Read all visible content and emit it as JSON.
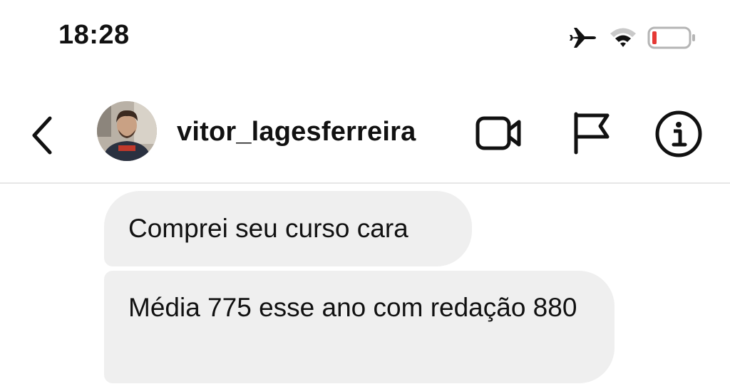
{
  "status_bar": {
    "time": "18:28",
    "icons": [
      "airplane-icon",
      "wifi-icon",
      "battery-icon"
    ],
    "battery_level_color": "#e53935"
  },
  "header": {
    "back_icon": "chevron-left-icon",
    "avatar": "avatar",
    "username": "vitor_lagesferreira",
    "actions": [
      "video-call-icon",
      "flag-icon",
      "info-icon"
    ]
  },
  "messages": [
    {
      "text": "Comprei seu curso cara"
    },
    {
      "text": "Média 775 esse ano com redação 880"
    }
  ],
  "colors": {
    "bubble_background": "#efefef",
    "divider": "#e6e6e6",
    "text": "#111111"
  }
}
